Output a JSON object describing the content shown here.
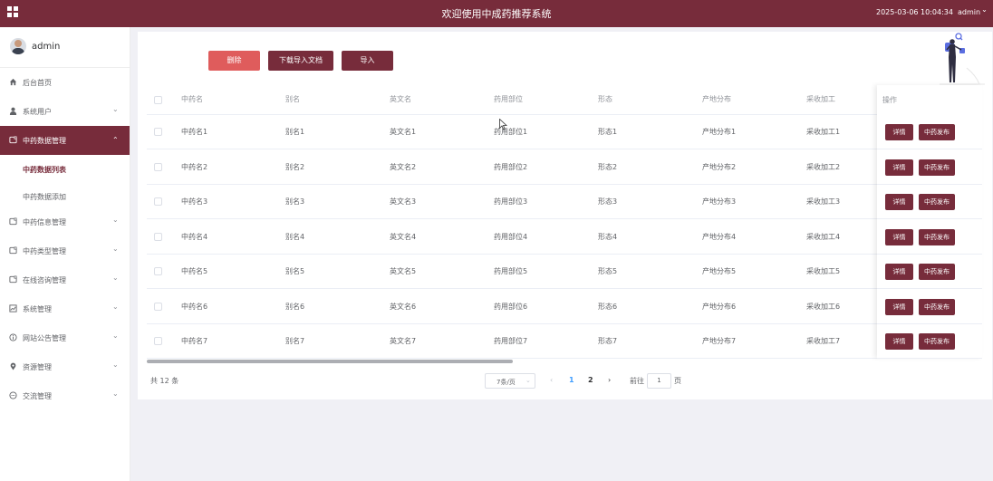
{
  "header": {
    "title": "欢迎使用中成药推荐系统",
    "datetime": "2025-03-06 10:04:34",
    "user": "admin",
    "user_caret": "⌄",
    "menu_icon": "grid-icon",
    "brand_color": "#772c3b"
  },
  "sidebar": {
    "profile_name": "admin",
    "items": [
      {
        "label": "后台首页",
        "icon": "home-icon",
        "has_arrow": false
      },
      {
        "label": "系统用户",
        "icon": "user-icon",
        "has_arrow": true
      },
      {
        "label": "中药数据管理",
        "icon": "folder-icon",
        "has_arrow": true,
        "active": true
      },
      {
        "label": "中药信息管理",
        "icon": "folder-icon",
        "has_arrow": true
      },
      {
        "label": "中药类型管理",
        "icon": "folder-icon",
        "has_arrow": true
      },
      {
        "label": "在线咨询管理",
        "icon": "folder-icon",
        "has_arrow": true
      },
      {
        "label": "系统管理",
        "icon": "chart-icon",
        "has_arrow": true
      },
      {
        "label": "网站公告管理",
        "icon": "info-icon",
        "has_arrow": true
      },
      {
        "label": "资源管理",
        "icon": "location-icon",
        "has_arrow": true
      },
      {
        "label": "交流管理",
        "icon": "chat-icon",
        "has_arrow": true
      }
    ],
    "sub_items": [
      {
        "label": "中药数据列表",
        "current": true
      },
      {
        "label": "中药数据添加",
        "current": false
      }
    ],
    "arrow_down": "⌄",
    "arrow_up": "⌃"
  },
  "toolbar": {
    "delete_label": "删除",
    "download_label": "下载导入文档",
    "import_label": "导入"
  },
  "table": {
    "columns": [
      "中药名",
      "别名",
      "英文名",
      "药用部位",
      "形态",
      "产地分布",
      "采收加工",
      "操作"
    ],
    "rows": [
      [
        "中药名1",
        "别名1",
        "英文名1",
        "药用部位1",
        "形态1",
        "产地分布1",
        "采收加工1"
      ],
      [
        "中药名2",
        "别名2",
        "英文名2",
        "药用部位2",
        "形态2",
        "产地分布2",
        "采收加工2"
      ],
      [
        "中药名3",
        "别名3",
        "英文名3",
        "药用部位3",
        "形态3",
        "产地分布3",
        "采收加工3"
      ],
      [
        "中药名4",
        "别名4",
        "英文名4",
        "药用部位4",
        "形态4",
        "产地分布4",
        "采收加工4"
      ],
      [
        "中药名5",
        "别名5",
        "英文名5",
        "药用部位5",
        "形态5",
        "产地分布5",
        "采收加工5"
      ],
      [
        "中药名6",
        "别名6",
        "英文名6",
        "药用部位6",
        "形态6",
        "产地分布6",
        "采收加工6"
      ],
      [
        "中药名7",
        "别名7",
        "英文名7",
        "药用部位7",
        "形态7",
        "产地分布7",
        "采收加工7"
      ]
    ],
    "detail_label": "详情",
    "publish_label": "中药发布"
  },
  "pagination": {
    "total_text": "共 12 条",
    "page_size": "7条/页",
    "pages": [
      "1",
      "2"
    ],
    "current_page": "1",
    "prev": "‹",
    "next": "›",
    "goto_label": "前往",
    "goto_value": "1",
    "goto_suffix": "页"
  }
}
